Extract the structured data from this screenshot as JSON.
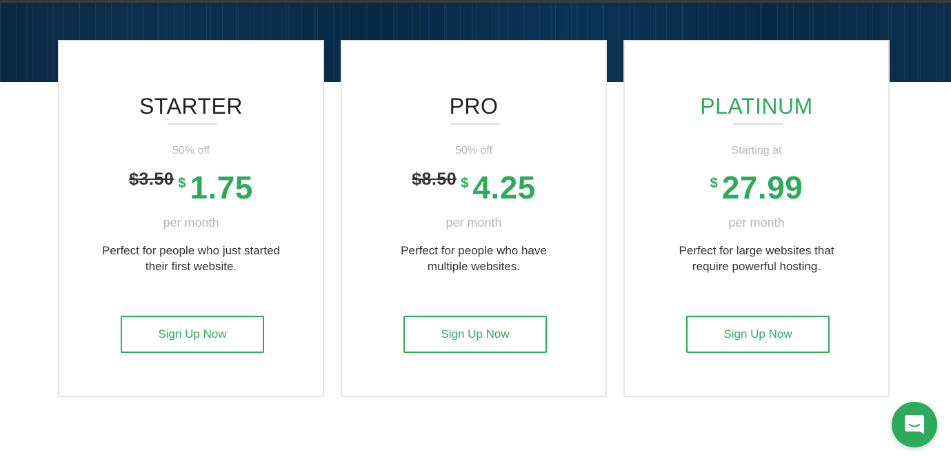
{
  "plans": [
    {
      "title": "STARTER",
      "subtitle": "50% off",
      "old_price": "$3.50",
      "currency": "$",
      "price": "1.75",
      "period": "per month",
      "description": "Perfect for people who just started their first website.",
      "button_label": "Sign Up Now"
    },
    {
      "title": "PRO",
      "subtitle": "50% off",
      "old_price": "$8.50",
      "currency": "$",
      "price": "4.25",
      "period": "per month",
      "description": "Perfect for people who have multiple websites.",
      "button_label": "Sign Up Now"
    },
    {
      "title": "PLATINUM",
      "subtitle": "Starting at",
      "old_price": "",
      "currency": "$",
      "price": "27.99",
      "period": "per month",
      "description": "Perfect for large websites that require powerful hosting.",
      "button_label": "Sign Up Now"
    }
  ],
  "colors": {
    "accent": "#2eaa5b",
    "hero_background": "#0b3150",
    "text_dark": "#222222",
    "text_muted": "#b7b7b7"
  },
  "chat_widget": {
    "icon": "chat-bubble-icon"
  }
}
